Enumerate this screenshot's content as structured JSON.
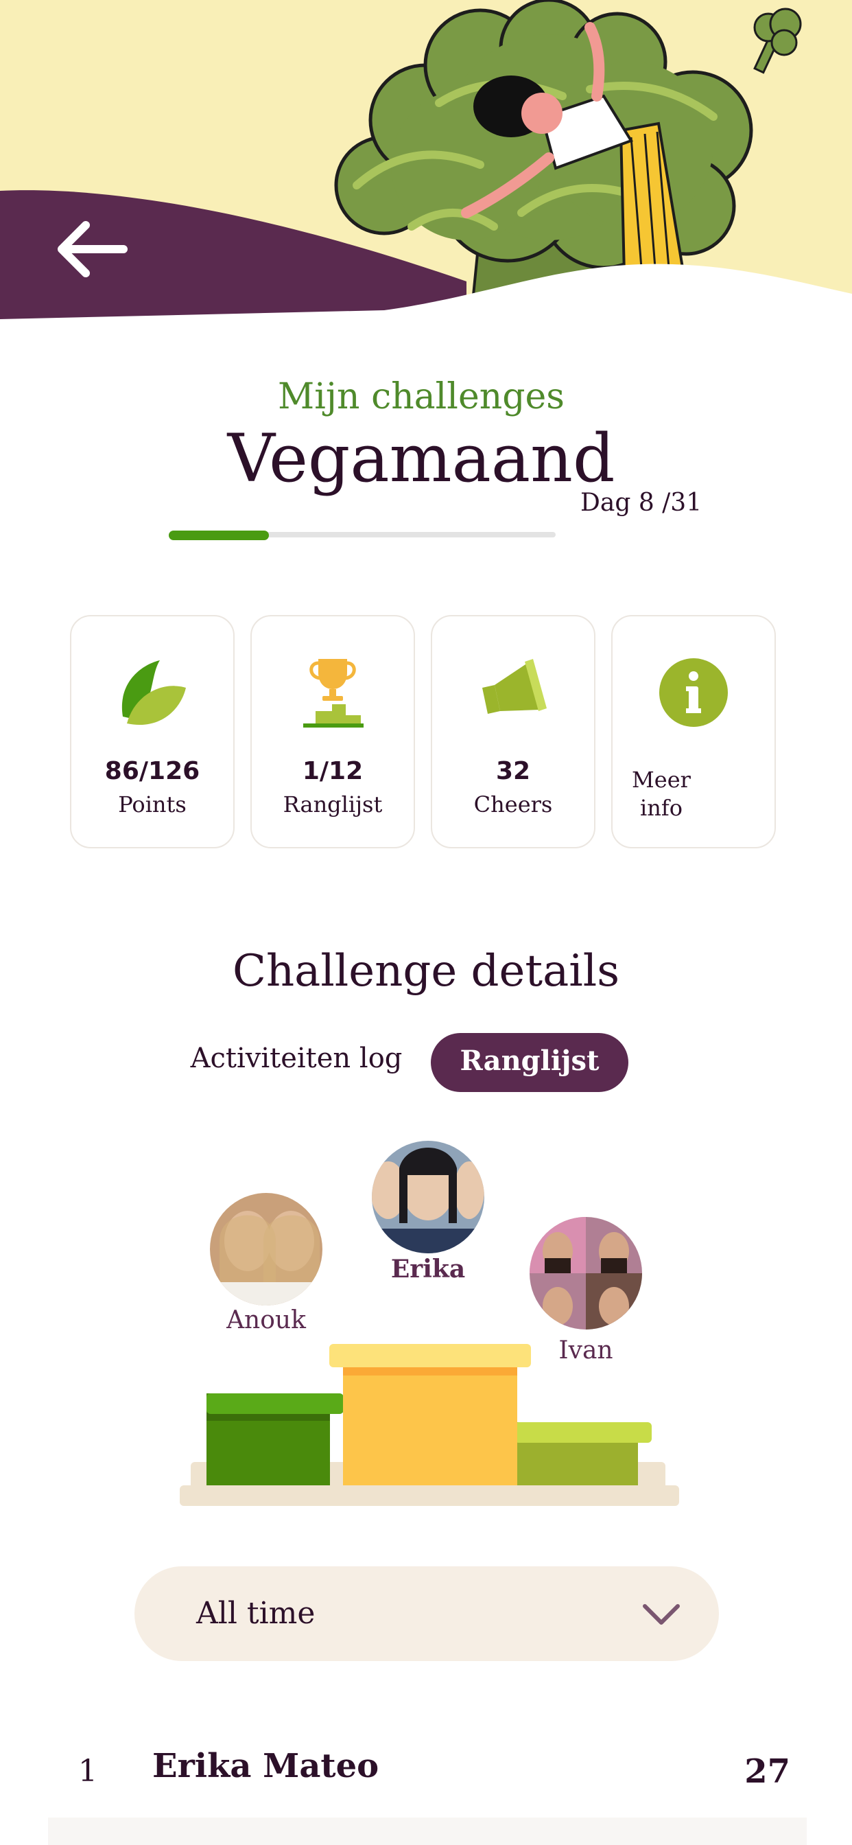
{
  "header": {
    "back_icon": "arrow-left-icon"
  },
  "challenge": {
    "section_label": "Mijn challenges",
    "name": "Vegamaand",
    "day_text": "Dag 8 /31",
    "day_current": 8,
    "day_total": 31
  },
  "stats": [
    {
      "value": "86/126",
      "label": "Points",
      "icon": "leaf-icon"
    },
    {
      "value": "1/12",
      "label": "Ranglijst",
      "icon": "trophy-podium-icon"
    },
    {
      "value": "32",
      "label": "Cheers",
      "icon": "megaphone-icon"
    },
    {
      "value": "",
      "label": "Meer info",
      "icon": "info-icon"
    }
  ],
  "details": {
    "heading": "Challenge details",
    "tabs": [
      {
        "label": "Activiteiten log",
        "active": false
      },
      {
        "label": "Ranglijst",
        "active": true
      }
    ]
  },
  "podium": [
    {
      "place": 2,
      "name": "Anouk"
    },
    {
      "place": 1,
      "name": "Erika"
    },
    {
      "place": 3,
      "name": "Ivan"
    }
  ],
  "filter": {
    "selected": "All time",
    "icon": "chevron-down-icon"
  },
  "leaderboard": [
    {
      "rank": "1",
      "name": "Erika Mateo",
      "points": "27"
    }
  ],
  "colors": {
    "accent_purple": "#5a2a4f",
    "accent_green": "#4a9b12",
    "title_green": "#4f8a2b",
    "header_yellow": "#f9efb7",
    "podium_gold": "#fdc54a"
  }
}
